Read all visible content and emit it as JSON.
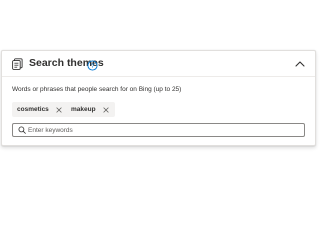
{
  "panel": {
    "title": "Search themes",
    "description": "Words or phrases that people search for on Bing (up to 25)",
    "header_icon": "tag-list-icon",
    "info_icon": "info-icon",
    "collapse_icon": "chevron-up-icon"
  },
  "chips": [
    {
      "label": "cosmetics",
      "remove_icon": "close-icon"
    },
    {
      "label": "makeup",
      "remove_icon": "close-icon"
    }
  ],
  "search": {
    "placeholder": "Enter keywords",
    "value": ""
  },
  "colors": {
    "accent": "#0078d4",
    "chip_background": "#f3f2f1",
    "text": "#323130",
    "border": "#8a8886"
  }
}
